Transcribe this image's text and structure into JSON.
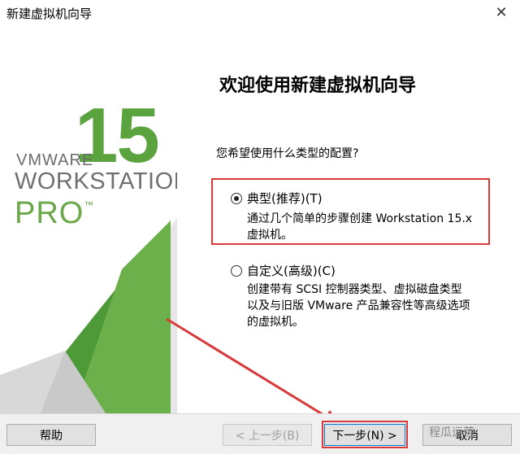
{
  "window": {
    "title": "新建虚拟机向导",
    "close_glyph": "✕"
  },
  "brand": {
    "version": "15",
    "vmware": "VMWARE",
    "workstation": "WORKSTATION",
    "pro": "PRO",
    "trademark": "™",
    "green": "#5ba33e"
  },
  "main": {
    "heading": "欢迎使用新建虚拟机向导",
    "question": "您希望使用什么类型的配置?",
    "options": [
      {
        "label": "典型(推荐)(T)",
        "desc_lines": [
          "通过几个简单的步骤创建 Workstation 15.x",
          "虚拟机。"
        ],
        "selected": true
      },
      {
        "label": "自定义(高级)(C)",
        "desc_lines": [
          "创建带有 SCSI 控制器类型、虚拟磁盘类型",
          "以及与旧版 VMware 产品兼容性等高级选项",
          "的虚拟机。"
        ],
        "selected": false
      }
    ]
  },
  "buttons": {
    "help": "帮助",
    "back": "< 上一步(B)",
    "next": "下一步(N) >",
    "cancel": "取消"
  },
  "watermark": "程瓜运营",
  "colors": {
    "highlight_red": "#d83a3a"
  }
}
